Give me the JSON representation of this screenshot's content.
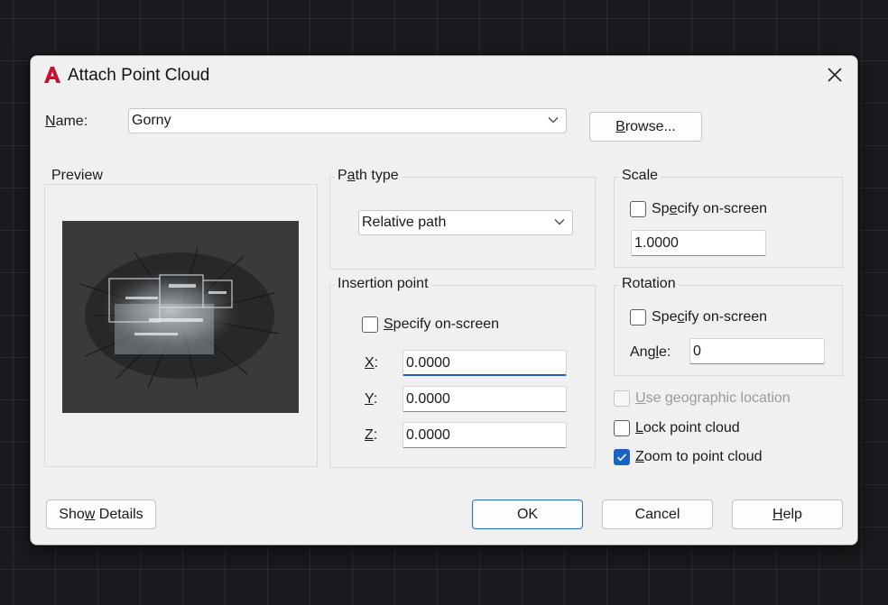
{
  "dialog": {
    "title": "Attach Point Cloud",
    "close_label": "×"
  },
  "name_row": {
    "label_hotkey": "N",
    "label_rest": "ame:",
    "value": "Gorny",
    "browse_hotkey": "B",
    "browse_rest": "rowse..."
  },
  "preview": {
    "title": "Preview"
  },
  "path_type": {
    "title_pre": "P",
    "title_hotkey": "a",
    "title_post": "th type",
    "value": "Relative path"
  },
  "insertion_point": {
    "title": "Insertion point",
    "specify_hotkey": "S",
    "specify_rest": "pecify on-screen",
    "specify_checked": false,
    "fields": [
      {
        "label_hotkey": "X",
        "label_rest": ":",
        "value": "0.0000"
      },
      {
        "label_hotkey": "Y",
        "label_rest": ":",
        "value": "0.0000"
      },
      {
        "label_hotkey": "Z",
        "label_rest": ":",
        "value": "0.0000"
      }
    ]
  },
  "scale": {
    "title": "Scale",
    "specify_pre": "Sp",
    "specify_hotkey": "e",
    "specify_post": "cify on-screen",
    "specify_checked": false,
    "value": "1.0000"
  },
  "rotation": {
    "title": "Rotation",
    "specify_pre": "Spe",
    "specify_hotkey": "c",
    "specify_post": "ify on-screen",
    "specify_checked": false,
    "angle_pre": "Ang",
    "angle_hotkey": "l",
    "angle_post": "e:",
    "angle_value": "0"
  },
  "options": {
    "geo_hotkey": "U",
    "geo_rest": "se geographic location",
    "geo_checked": false,
    "geo_disabled": true,
    "lock_hotkey": "L",
    "lock_rest": "ock point cloud",
    "lock_checked": false,
    "zoom_hotkey": "Z",
    "zoom_rest": "oom to point cloud",
    "zoom_checked": true
  },
  "footer": {
    "details_pre": "Sho",
    "details_hotkey": "w",
    "details_post": " Details",
    "ok_label": "OK",
    "cancel_label": "Cancel",
    "help_hotkey": "H",
    "help_rest": "elp"
  },
  "colors": {
    "accent": "#1863c4",
    "autocad_red": "#c8102e",
    "preview_bg": "#3a3a3a"
  },
  "icons": {
    "app": "autocad-logo-icon",
    "close": "close-icon",
    "dropdown": "chevron-down-icon",
    "check": "checkmark-icon"
  }
}
